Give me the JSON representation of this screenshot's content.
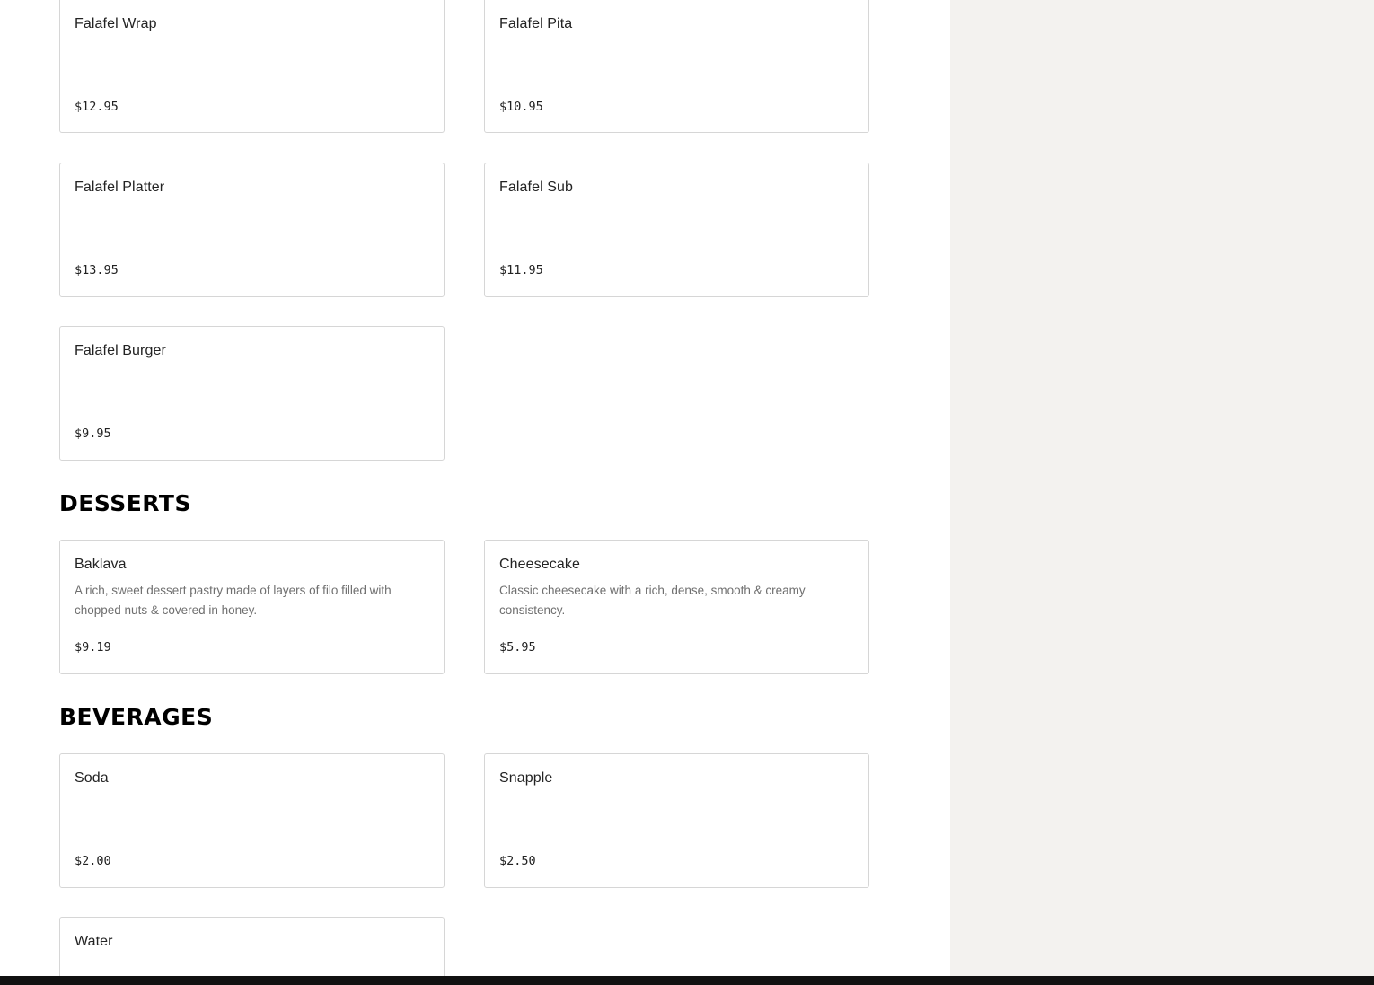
{
  "sections": {
    "falafel": {
      "items": [
        {
          "name": "Falafel Wrap",
          "price": "$12.95"
        },
        {
          "name": "Falafel Pita",
          "price": "$10.95"
        },
        {
          "name": "Falafel Platter",
          "price": "$13.95"
        },
        {
          "name": "Falafel Sub",
          "price": "$11.95"
        },
        {
          "name": "Falafel Burger",
          "price": "$9.95"
        }
      ]
    },
    "desserts": {
      "title": "DESSERTS",
      "items": [
        {
          "name": "Baklava",
          "description": "A rich, sweet dessert pastry made of layers of filo filled with chopped nuts & covered in honey.",
          "price": "$9.19"
        },
        {
          "name": "Cheesecake",
          "description": "Classic cheesecake with a rich, dense, smooth & creamy consistency.",
          "price": "$5.95"
        }
      ]
    },
    "beverages": {
      "title": "BEVERAGES",
      "items": [
        {
          "name": "Soda",
          "price": "$2.00"
        },
        {
          "name": "Snapple",
          "price": "$2.50"
        },
        {
          "name": "Water"
        }
      ]
    }
  },
  "colors": {
    "sidebar_bg": "#f3f2ef",
    "card_border": "#d6d6d6",
    "bottom_bar": "#111111"
  }
}
